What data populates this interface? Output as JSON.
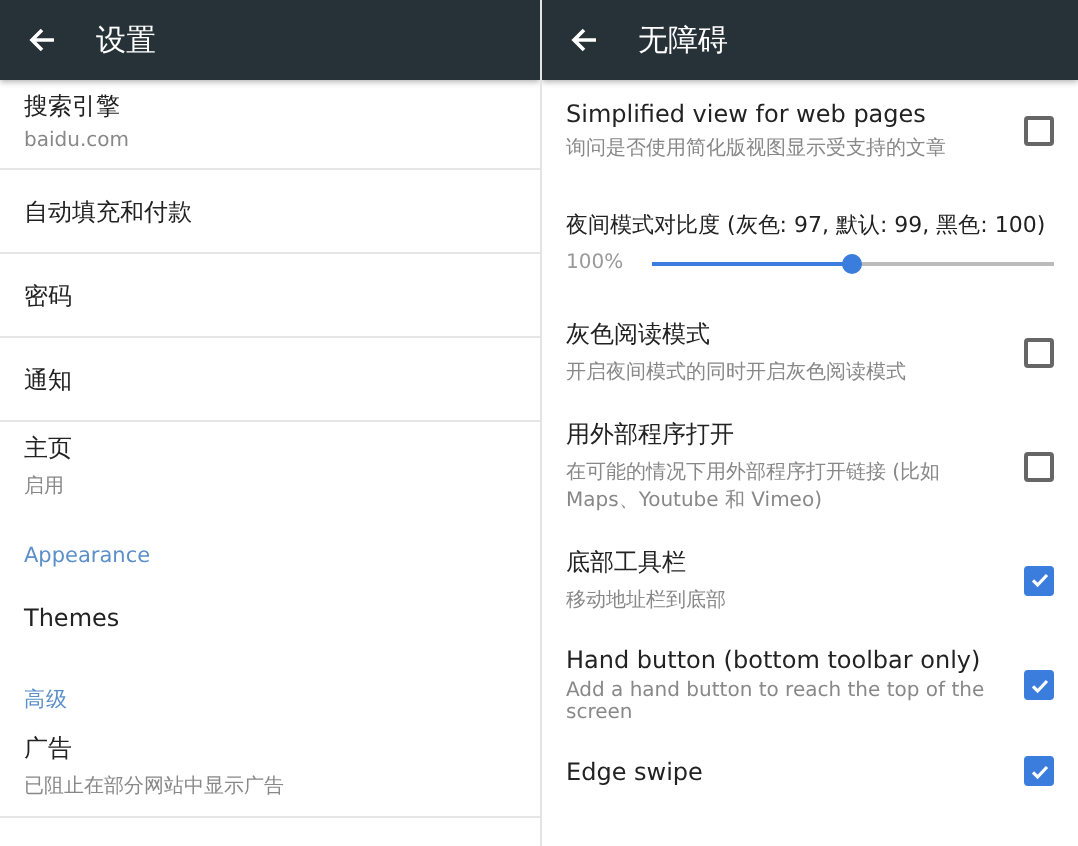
{
  "panels": [
    {
      "title": "设置",
      "items": [
        {
          "kind": "item",
          "title": "搜索引擎",
          "subtitle": "baidu.com"
        },
        {
          "kind": "item",
          "title": "自动填充和付款"
        },
        {
          "kind": "item",
          "title": "密码"
        },
        {
          "kind": "item",
          "title": "通知"
        },
        {
          "kind": "item",
          "title": "主页",
          "subtitle": "启用"
        },
        {
          "kind": "header",
          "title": "Appearance"
        },
        {
          "kind": "item",
          "title": "Themes"
        },
        {
          "kind": "header",
          "title": "高级"
        },
        {
          "kind": "item",
          "title": "广告",
          "subtitle": "已阻止在部分网站中显示广告"
        }
      ]
    },
    {
      "title": "无障碍",
      "items": [
        {
          "kind": "checkbox",
          "title": "Simplified view for web pages",
          "subtitle": "询问是否使用简化版视图显示受支持的文章",
          "checked": false
        },
        {
          "kind": "slider",
          "title": "夜间模式对比度 (灰色: 97, 默认: 99, 黑色: 100)",
          "reading": "100%",
          "level": 0.5
        },
        {
          "kind": "checkbox",
          "title": "灰色阅读模式",
          "subtitle": "开启夜间模式的同时开启灰色阅读模式",
          "checked": false
        },
        {
          "kind": "checkbox",
          "title": "用外部程序打开",
          "subtitle": "在可能的情况下用外部程序打开链接 (比如 Maps、Youtube 和 Vimeo)",
          "checked": false
        },
        {
          "kind": "checkbox",
          "title": "底部工具栏",
          "subtitle": "移动地址栏到底部",
          "checked": true
        },
        {
          "kind": "checkbox",
          "title": "Hand button (bottom toolbar only)",
          "subtitle": "Add a hand button to reach the top of the screen",
          "checked": true
        },
        {
          "kind": "checkbox",
          "title": "Edge swipe",
          "checked": true
        }
      ]
    }
  ]
}
